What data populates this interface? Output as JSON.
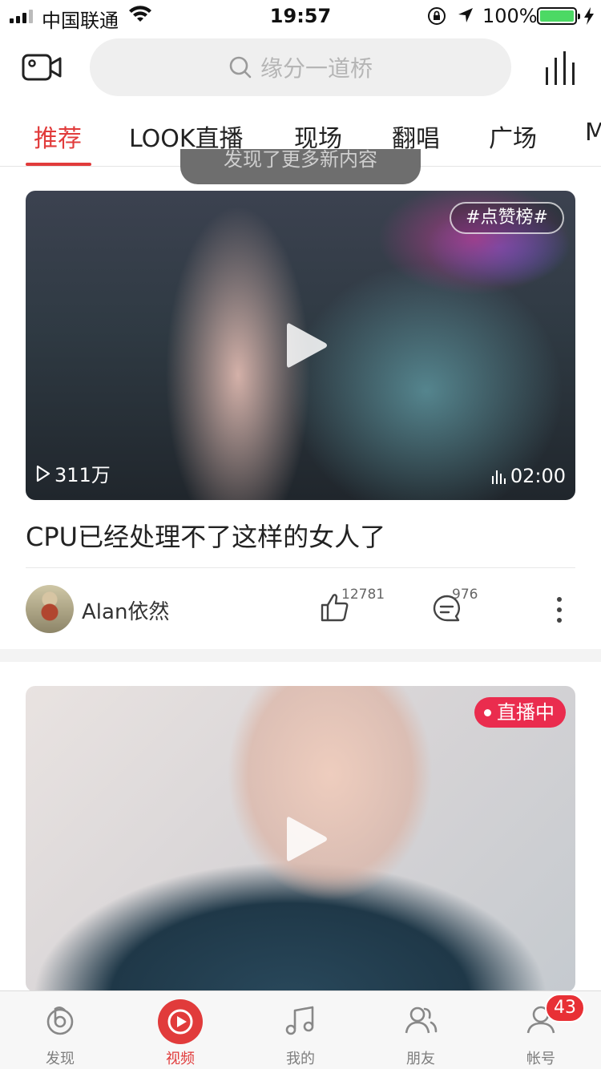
{
  "status_bar": {
    "carrier": "中国联通",
    "time": "19:57",
    "battery_pct": "100%"
  },
  "search": {
    "placeholder": "缘分一道桥"
  },
  "tabs": [
    {
      "label": "推荐",
      "active": true
    },
    {
      "label": "LOOK直播",
      "active": false
    },
    {
      "label": "现场",
      "active": false
    },
    {
      "label": "翻唱",
      "active": false
    },
    {
      "label": "广场",
      "active": false
    },
    {
      "label": "M",
      "active": false
    }
  ],
  "toast": "发现了更多新内容",
  "feed": [
    {
      "badge": "#点赞榜#",
      "views": "311万",
      "duration": "02:00",
      "title": "CPU已经处理不了这样的女人了",
      "author": "Alan依然",
      "likes": "12781",
      "comments": "976"
    },
    {
      "live_label": "直播中"
    }
  ],
  "bottom_nav": [
    {
      "label": "发现",
      "icon": "discover-icon"
    },
    {
      "label": "视频",
      "icon": "video-play-icon",
      "active": true
    },
    {
      "label": "我的",
      "icon": "music-note-icon"
    },
    {
      "label": "朋友",
      "icon": "friends-icon"
    },
    {
      "label": "帐号",
      "icon": "account-icon"
    }
  ],
  "notification_count": "43",
  "colors": {
    "accent": "#e13b3b",
    "live": "#ea2c4e",
    "battery": "#4cd964"
  }
}
